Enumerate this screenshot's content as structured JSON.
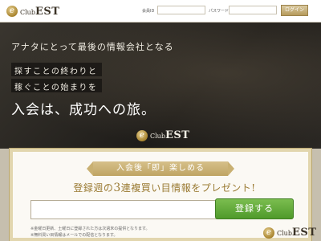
{
  "header": {
    "logo_small": "Club",
    "logo_big": "EST",
    "member_id_label": "会員ID",
    "password_label": "パスワード",
    "login_button": "ログイン"
  },
  "hero": {
    "line1": "アナタにとって最後の情報会社となる",
    "line2": "探すことの終わりと",
    "line3": "稼ぐことの始まりを",
    "tagline": "入会は、成功への旅。",
    "logo_small": "Club",
    "logo_big": "EST"
  },
  "signup": {
    "ribbon": "入会後「即」楽しめる",
    "headline_pre": "登録週の",
    "headline_num": "3",
    "headline_post": "連複買い目情報をプレゼント!",
    "email_value": "",
    "submit_label": "登録する",
    "note1": "※金曜日更新、土曜日に登録された方は次週末の提供となります。",
    "note2": "※無料買い目情報はメールでの配信となります。",
    "logo_small": "Club",
    "logo_big": "EST"
  },
  "colors": {
    "gold": "#b59a5c",
    "green": "#5aa634",
    "dark_bg": "#2b2925"
  }
}
